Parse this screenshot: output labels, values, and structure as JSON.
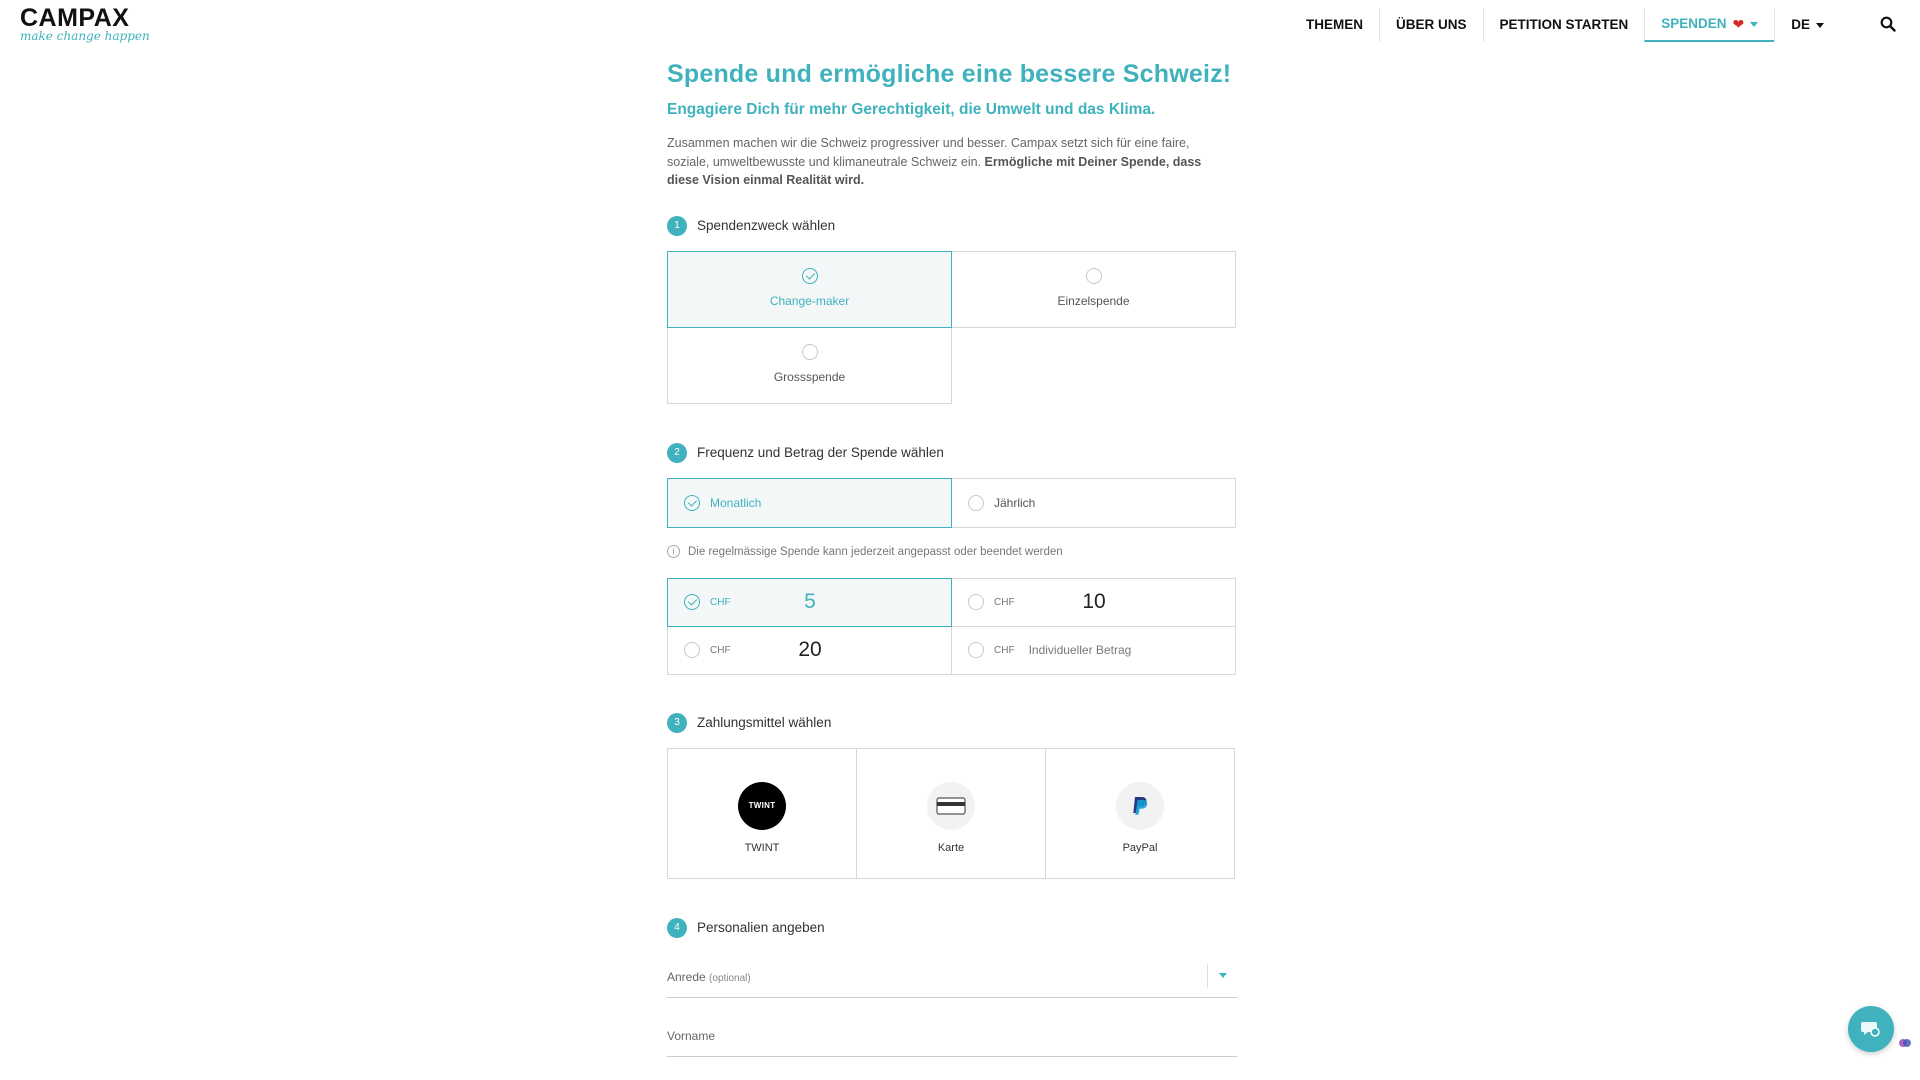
{
  "header": {
    "logo_main": "CAMPAX",
    "logo_sub": "make change happen",
    "nav": [
      {
        "label": "THEMEN"
      },
      {
        "label": "ÜBER UNS"
      },
      {
        "label": "PETITION STARTEN"
      },
      {
        "label": "SPENDEN",
        "icon": "heart-icon",
        "active": true
      },
      {
        "label": "DE"
      }
    ],
    "search_icon": "search-icon"
  },
  "page": {
    "title": "Spende und ermögliche eine bessere Schweiz!",
    "subtitle": "Engagiere Dich für mehr Gerechtigkeit, die Umwelt und das Klima.",
    "intro_plain": "Zusammen machen wir die Schweiz progressiver und besser. Campax setzt sich für eine faire, soziale, umweltbewusste und klimaneutrale Schweiz ein. ",
    "intro_bold": "Ermögliche mit Deiner Spende, dass diese Vision einmal Realität wird."
  },
  "step1": {
    "number": "1",
    "title": "Spendenzweck wählen",
    "options": [
      {
        "label": "Change-maker",
        "selected": true
      },
      {
        "label": "Einzelspende",
        "selected": false
      },
      {
        "label": "Grossspende",
        "selected": false
      }
    ]
  },
  "step2": {
    "number": "2",
    "title": "Frequenz und Betrag der Spende wählen",
    "frequency": [
      {
        "label": "Monatlich",
        "selected": true
      },
      {
        "label": "Jährlich",
        "selected": false
      }
    ],
    "info": "Die regelmässige Spende kann jederzeit angepasst oder beendet werden",
    "currency": "CHF",
    "amounts": [
      {
        "value": "5",
        "selected": true
      },
      {
        "value": "10",
        "selected": false
      },
      {
        "value": "20",
        "selected": false
      }
    ],
    "custom_amount": "Individueller Betrag"
  },
  "step3": {
    "number": "3",
    "title": "Zahlungsmittel wählen",
    "methods": [
      {
        "label": "TWINT",
        "logo_text": "TWINT"
      },
      {
        "label": "Karte"
      },
      {
        "label": "PayPal"
      }
    ]
  },
  "step4": {
    "number": "4",
    "title": "Personalien angeben",
    "salutation_label": "Anrede",
    "salutation_note": "(optional)",
    "firstname_label": "Vorname"
  },
  "colors": {
    "accent": "#3fb2bd",
    "heart": "#d9262b"
  }
}
